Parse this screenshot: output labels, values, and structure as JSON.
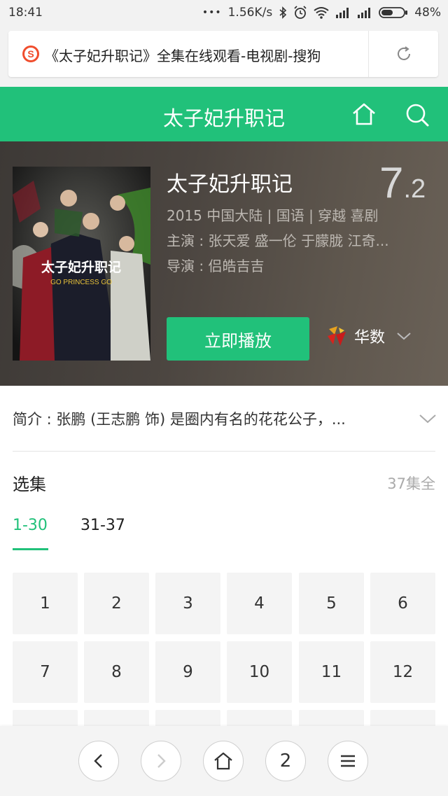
{
  "status_bar": {
    "time": "18:41",
    "dots": "•••",
    "speed": "1.56K/s",
    "battery": "48%",
    "icons": [
      "bluetooth-icon",
      "alarm-icon",
      "wifi-icon",
      "signal-icon",
      "signal-icon",
      "battery-icon"
    ]
  },
  "browser": {
    "url_title": "《太子妃升职记》全集在线观看-电视剧-搜狗",
    "favicon": "sogou-logo",
    "reload_icon": "reload-icon"
  },
  "header": {
    "title": "太子妃升职记",
    "home_icon": "home-icon",
    "search_icon": "search-icon",
    "bg_color": "#21c17a"
  },
  "show": {
    "title": "太子妃升职记",
    "rating_int": "7",
    "rating_dec": ".2",
    "meta_line": "2015   中国大陆 | 国语 | 穿越 喜剧",
    "cast": "主演 : 张天爱  盛一伦  于朦胧  江奇...",
    "director": "导演 : 侣皓吉吉",
    "poster_title": "太子妃升职记",
    "poster_subtitle": "GO PRINCESS GO",
    "play_label": "立即播放",
    "source_label": "华数"
  },
  "intro": {
    "text": "简介 : 张鹏 (王志鹏 饰) 是圈内有名的花花公子，..."
  },
  "episodes_section": {
    "title": "选集",
    "total": "37集全",
    "tabs": [
      "1-30",
      "31-37"
    ],
    "episodes": [
      "1",
      "2",
      "3",
      "4",
      "5",
      "6",
      "7",
      "8",
      "9",
      "10",
      "11",
      "12"
    ]
  },
  "bottom_nav": {
    "back_icon": "back-icon",
    "forward_icon": "forward-icon",
    "home_icon": "home-icon",
    "tabs_count": "2",
    "menu_icon": "menu-icon"
  }
}
